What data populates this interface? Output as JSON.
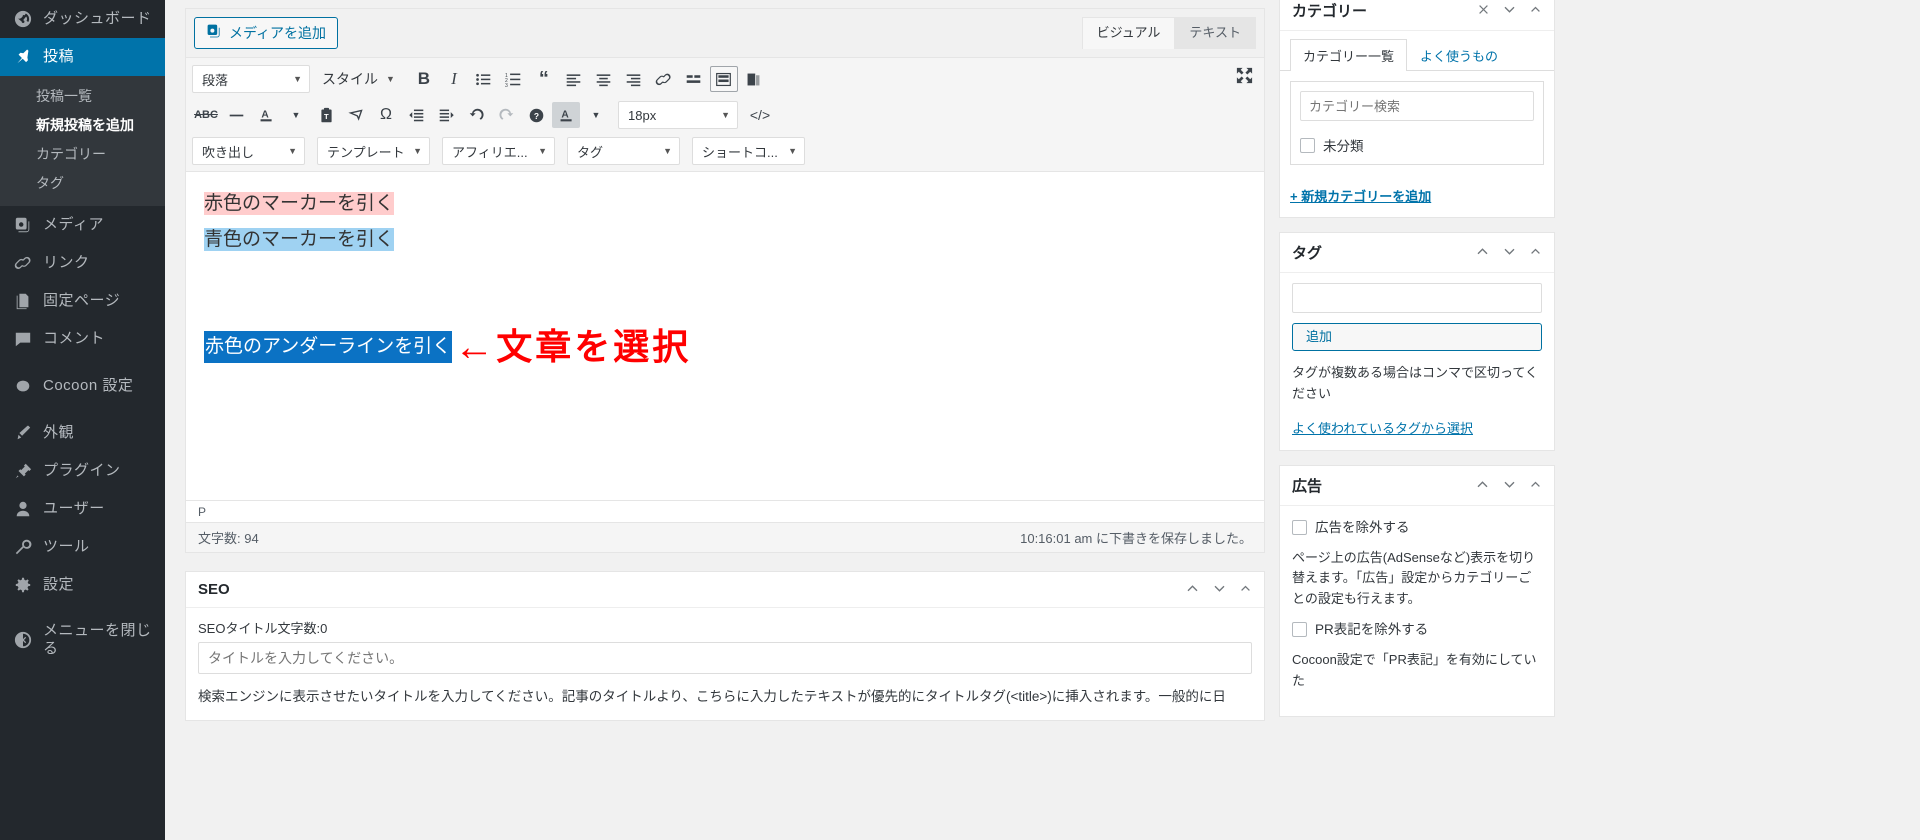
{
  "sidebar": {
    "items": [
      {
        "label": "ダッシュボード",
        "icon": "dashboard-icon",
        "current": false
      },
      {
        "label": "投稿",
        "icon": "pin-icon",
        "current": true
      },
      {
        "label": "メディア",
        "icon": "media-icon",
        "current": false
      },
      {
        "label": "リンク",
        "icon": "link-icon",
        "current": false
      },
      {
        "label": "固定ページ",
        "icon": "page-icon",
        "current": false
      },
      {
        "label": "コメント",
        "icon": "comment-icon",
        "current": false
      },
      {
        "label": "Cocoon 設定",
        "icon": "cocoon-icon",
        "current": false
      },
      {
        "label": "外観",
        "icon": "appearance-icon",
        "current": false
      },
      {
        "label": "プラグイン",
        "icon": "plugin-icon",
        "current": false
      },
      {
        "label": "ユーザー",
        "icon": "user-icon",
        "current": false
      },
      {
        "label": "ツール",
        "icon": "tools-icon",
        "current": false
      },
      {
        "label": "設定",
        "icon": "settings-icon",
        "current": false
      },
      {
        "label": "メニューを閉じる",
        "icon": "collapse-icon",
        "current": false
      }
    ],
    "submenu": [
      {
        "label": "投稿一覧",
        "active": false
      },
      {
        "label": "新規投稿を追加",
        "active": true
      },
      {
        "label": "カテゴリー",
        "active": false
      },
      {
        "label": "タグ",
        "active": false
      }
    ]
  },
  "editor": {
    "add_media_label": "メディアを追加",
    "tabs": [
      {
        "label": "ビジュアル",
        "active": true
      },
      {
        "label": "テキスト",
        "active": false
      }
    ],
    "format_select": "段落",
    "style_select": "スタイル",
    "font_size": "18px",
    "dropdowns": [
      "吹き出し",
      "テンプレート",
      "アフィリエ...",
      "タグ",
      "ショートコ..."
    ],
    "content": {
      "line1": "赤色のマーカーを引く",
      "line2": "青色のマーカーを引く",
      "selected_line": "赤色のアンダーラインを引く",
      "annotation_arrow": "←",
      "annotation_text": "文章を選択"
    },
    "path": "P",
    "word_count": "文字数: 94",
    "save_status": "10:16:01 am に下書きを保存しました。"
  },
  "seo_box": {
    "title": "SEO",
    "title_count_label": "SEOタイトル文字数:0",
    "title_placeholder": "タイトルを入力してください。",
    "description": "検索エンジンに表示させたいタイトルを入力してください。記事のタイトルより、こちらに入力したテキストが優先的にタイトルタグ(<title>)に挿入されます。一般的に日"
  },
  "category_box": {
    "title": "カテゴリー",
    "tabs": [
      {
        "label": "カテゴリー一覧",
        "active": true
      },
      {
        "label": "よく使うもの",
        "active": false
      }
    ],
    "search_placeholder": "カテゴリー検索",
    "items": [
      {
        "label": "未分類",
        "checked": false
      }
    ],
    "add_new_link": "+ 新規カテゴリーを追加"
  },
  "tag_box": {
    "title": "タグ",
    "input_value": "",
    "add_button": "追加",
    "help_text": "タグが複数ある場合はコンマで区切ってください",
    "choose_link": "よく使われているタグから選択"
  },
  "ad_box": {
    "title": "広告",
    "exclude_ads_label": "広告を除外する",
    "description": "ページ上の広告(AdSenseなど)表示を切り替えます。「広告」設定からカテゴリーごとの設定も行えます。",
    "exclude_pr_label": "PR表記を除外する",
    "pr_description": "Cocoon設定で「PR表記」を有効にしていた"
  },
  "icons": {
    "collapse_handles": [
      "chevron-up",
      "chevron-down",
      "chevron-toggle"
    ]
  },
  "colors": {
    "accent": "#0073aa",
    "sidebar_bg": "#23282d",
    "marker_red": "#ffcccc",
    "marker_blue": "#9fd2f2",
    "selection_blue": "#0b72c4",
    "annotation_red": "#ff0000"
  }
}
